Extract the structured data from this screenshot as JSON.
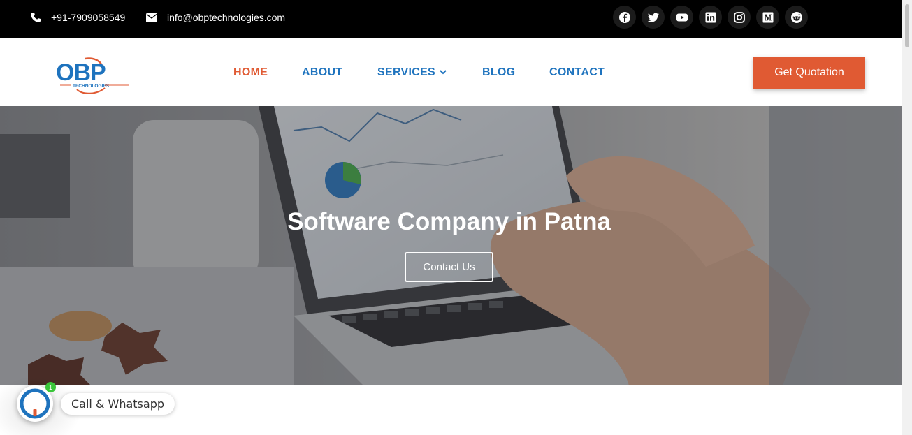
{
  "topbar": {
    "phone": "+91-7909058549",
    "email": "info@obptechnologies.com",
    "socials": [
      "facebook-icon",
      "twitter-icon",
      "youtube-icon",
      "linkedin-icon",
      "instagram-icon",
      "medium-icon",
      "reddit-icon"
    ]
  },
  "header": {
    "logo_text": "OBP",
    "logo_subtext": "TECHNOLOGIES",
    "nav": {
      "home": "HOME",
      "about": "ABOUT",
      "services": "SERVICES",
      "blog": "BLOG",
      "contact": "CONTACT"
    },
    "cta": "Get Quotation"
  },
  "hero": {
    "title": "Software Company in Patna",
    "button": "Contact Us"
  },
  "widget": {
    "label": "Call & Whatsapp",
    "badge": "1"
  },
  "colors": {
    "accent": "#e05a33",
    "brand_blue": "#1e73be",
    "topbar_bg": "#000000"
  }
}
